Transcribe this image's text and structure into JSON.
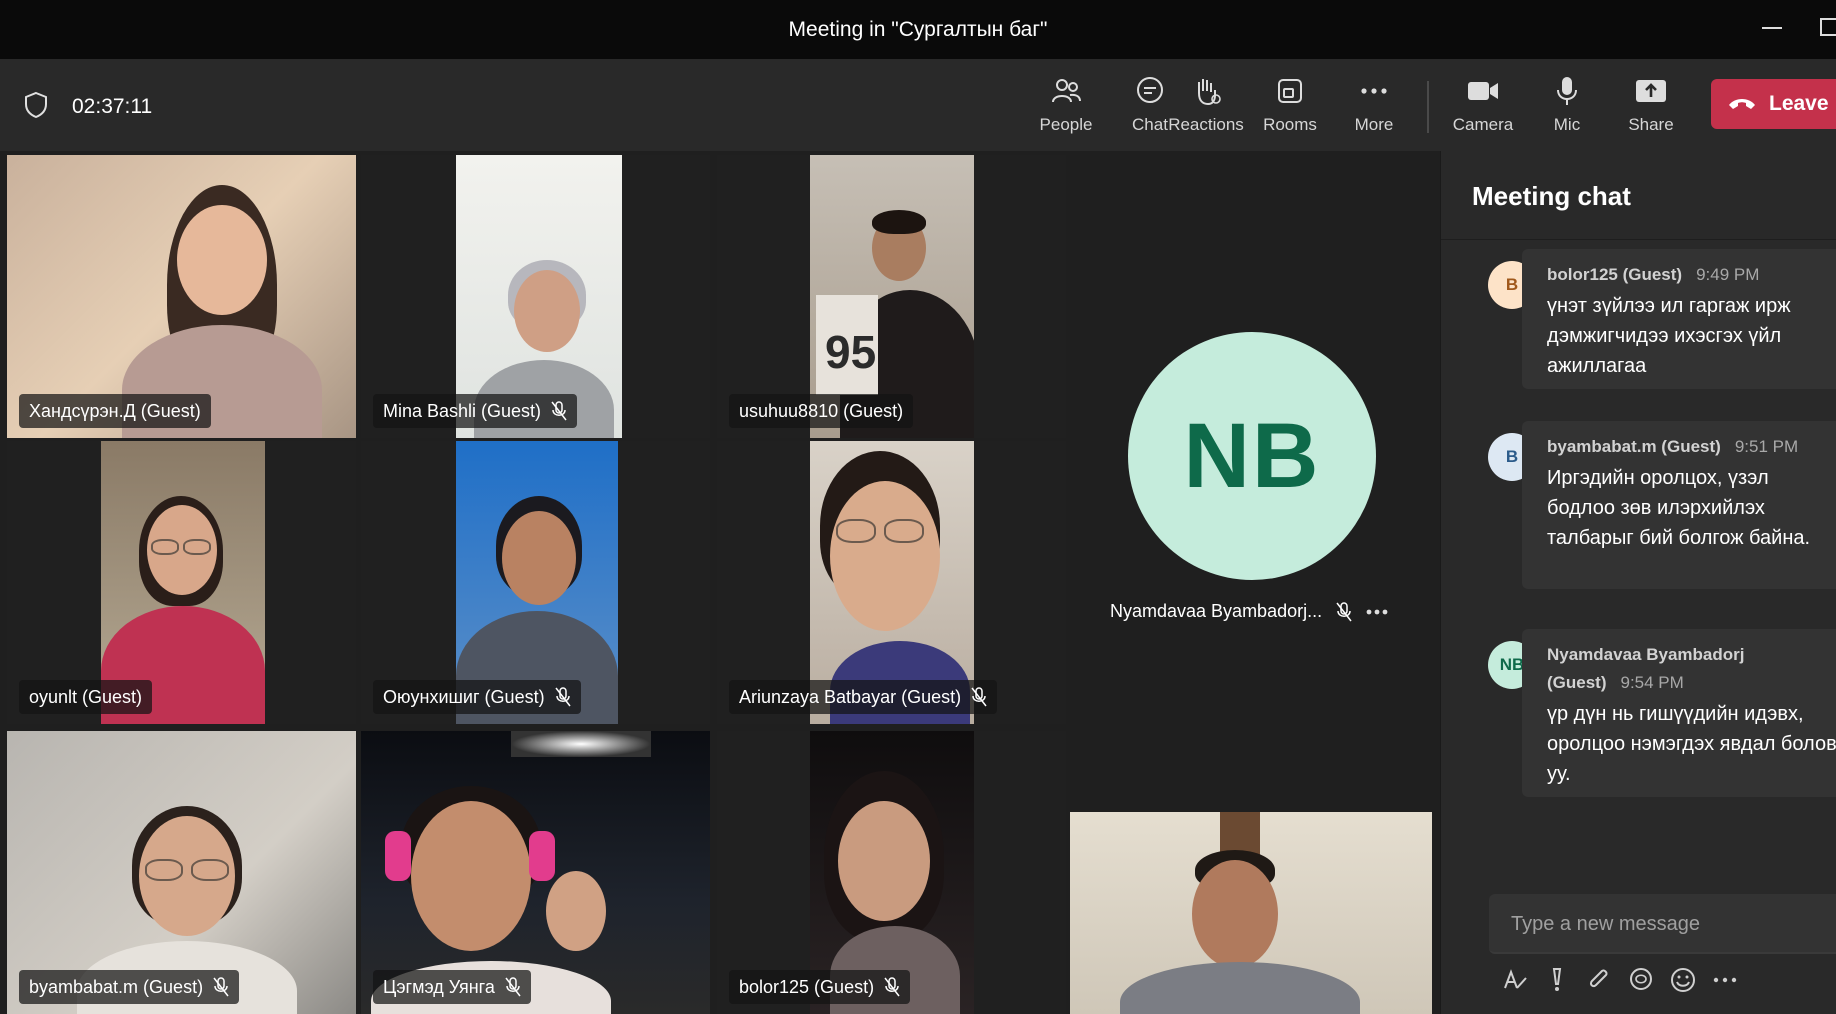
{
  "window": {
    "title": "Meeting in \"Сургалтын баг\""
  },
  "toolbar": {
    "timer": "02:37:11",
    "buttons": [
      {
        "id": "people",
        "label": "People",
        "icon": "people-icon"
      },
      {
        "id": "chat",
        "label": "Chat",
        "icon": "chat-icon"
      },
      {
        "id": "reactions",
        "label": "Reactions",
        "icon": "hand-icon"
      },
      {
        "id": "rooms",
        "label": "Rooms",
        "icon": "rooms-icon"
      },
      {
        "id": "more",
        "label": "More",
        "icon": "more-icon"
      },
      {
        "id": "camera",
        "label": "Camera",
        "icon": "camera-icon"
      },
      {
        "id": "mic",
        "label": "Mic",
        "icon": "mic-icon"
      },
      {
        "id": "share",
        "label": "Share",
        "icon": "share-icon"
      }
    ],
    "leave_label": "Leave"
  },
  "participants": [
    {
      "name": "Хандсүрэн.Д (Guest)",
      "muted": false
    },
    {
      "name": "Mina Bashli (Guest)",
      "muted": true
    },
    {
      "name": "usuhuu8810 (Guest)",
      "muted": false
    },
    {
      "name": "oyunlt (Guest)",
      "muted": false
    },
    {
      "name": "Оюунхишиг (Guest)",
      "muted": true
    },
    {
      "name": "Ariunzaya Batbayar (Guest)",
      "muted": true
    },
    {
      "name": "byambabat.m (Guest)",
      "muted": true
    },
    {
      "name": "Цэгмэд Уянга",
      "muted": true
    },
    {
      "name": "bolor125 (Guest)",
      "muted": true
    }
  ],
  "spotlight": {
    "initials": "NB",
    "name": "Nyamdavaa Byambadorj...",
    "muted": true
  },
  "chat": {
    "title": "Meeting chat",
    "messages": [
      {
        "initial": "B",
        "author": "bolor125 (Guest)",
        "time": "9:49 PM",
        "text": "үнэт зүйлээ ил гаргаж ирж дэмжигчидээ ихэсгэх үйл ажиллагаа"
      },
      {
        "initial": "B",
        "author": "byambabat.m (Guest)",
        "time": "9:51 PM",
        "text": "Иргэдийн оролцох, үзэл бодлоо зөв илэрхийлэх талбарыг бий болгож байна."
      },
      {
        "initial": "NB",
        "author": "Nyamdavaa Byambadorj (Guest)",
        "time": "9:54 PM",
        "text": "үр дүн нь гишүүдийн идэвх, оролцоо нэмэгдэх явдал болов уу."
      }
    ],
    "compose_placeholder": "Type a new message",
    "compose_icons": [
      "format-icon",
      "important-icon",
      "attach-icon",
      "loop-icon",
      "emoji-icon",
      "more-icon"
    ]
  },
  "colors": {
    "leave": "#c4314b",
    "nb_avatar_bg": "#c5ecdc",
    "nb_avatar_fg": "#0e6a4a",
    "status_dot": "#e3203d"
  }
}
